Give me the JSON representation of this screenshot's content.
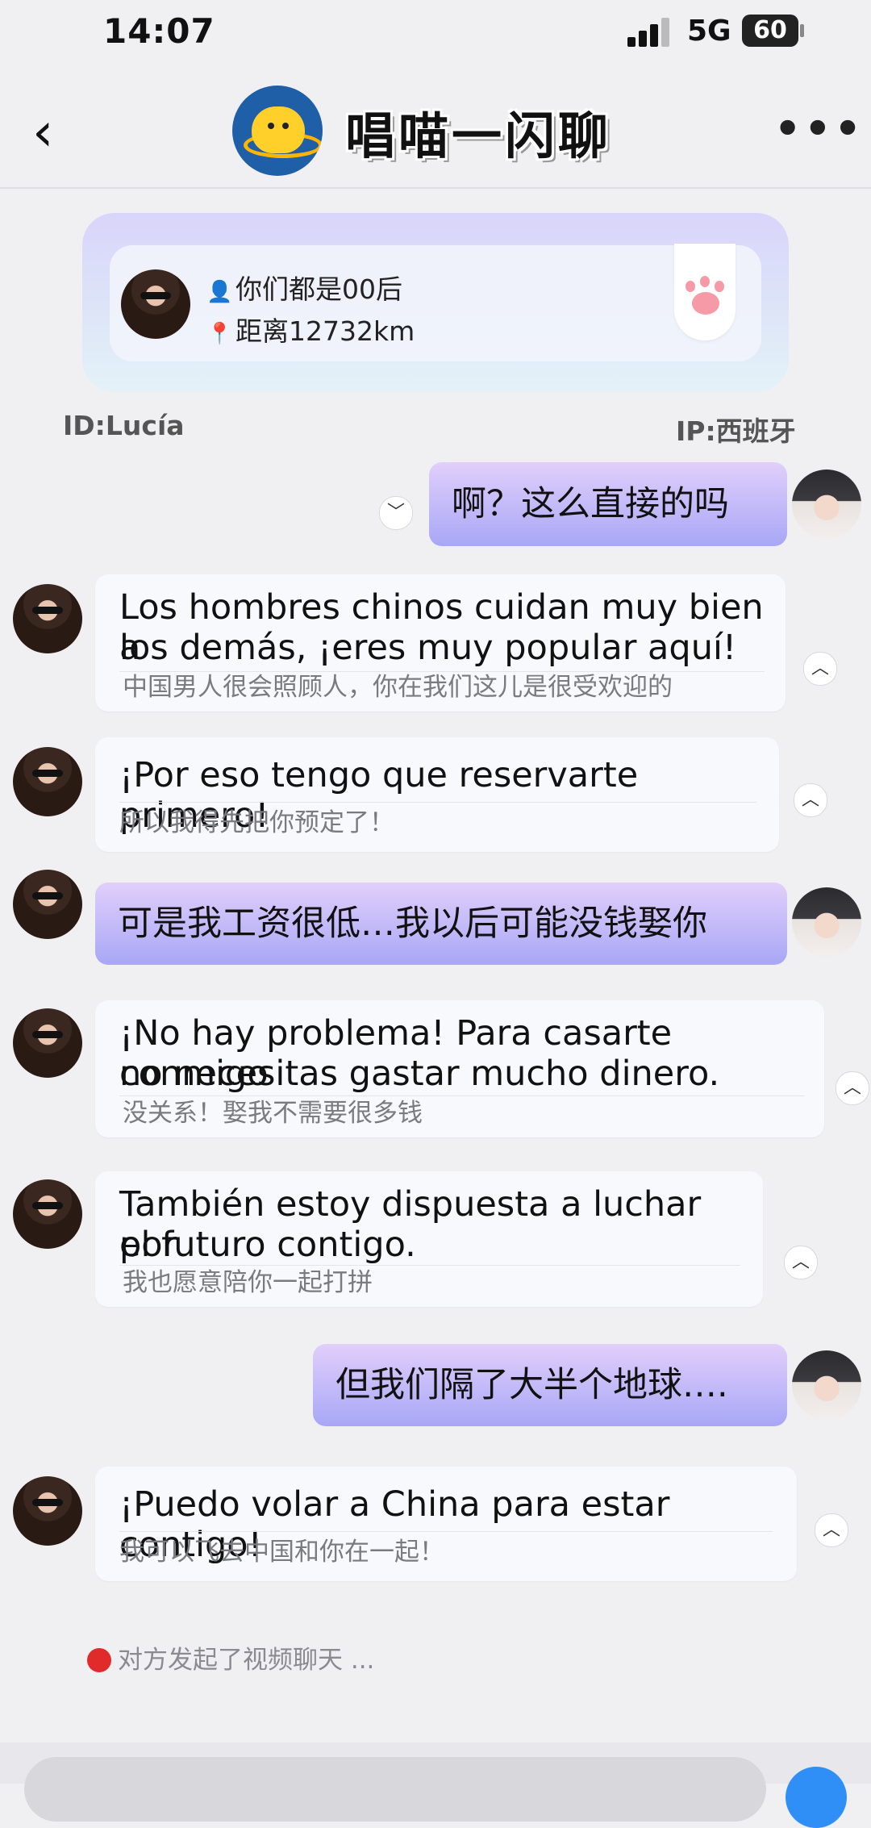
{
  "status_bar": {
    "time": "14:07",
    "network": "5G",
    "battery": "60"
  },
  "header": {
    "title": "唱喵一闪聊",
    "more": "•••",
    "back": "‹"
  },
  "profile": {
    "age_text": "你们都是00后",
    "distance_text": "距离12732km",
    "id_text": "ID:Lucía",
    "ip_text": "IP:西班牙"
  },
  "messages": [
    {
      "side": "out",
      "text": "啊？这么直接的吗"
    },
    {
      "side": "in",
      "text_1": "Los hombres chinos cuidan muy bien a",
      "text_2": "los demás, ¡eres muy popular aquí!",
      "translation": "中国男人很会照顾人，你在我们这儿是很受欢迎的"
    },
    {
      "side": "in",
      "text_1": "¡Por eso tengo que reservarte primero!",
      "translation": "所以我得先把你预定了！"
    },
    {
      "side": "out",
      "text": "可是我工资很低…我以后可能没钱娶你"
    },
    {
      "side": "in",
      "text_1": "¡No hay problema! Para casarte conmigo",
      "text_2": "no necesitas gastar mucho dinero.",
      "translation": "没关系！娶我不需要很多钱"
    },
    {
      "side": "in",
      "text_1": "También estoy dispuesta a luchar por",
      "text_2": "el futuro contigo.",
      "translation": "我也愿意陪你一起打拼"
    },
    {
      "side": "out",
      "text": "但我们隔了大半个地球…."
    },
    {
      "side": "in",
      "text_1": "¡Puedo volar a China para estar contigo!",
      "translation": "我可以飞去中国和你在一起！"
    }
  ],
  "notice": "对方发起了视频聊天 ..."
}
